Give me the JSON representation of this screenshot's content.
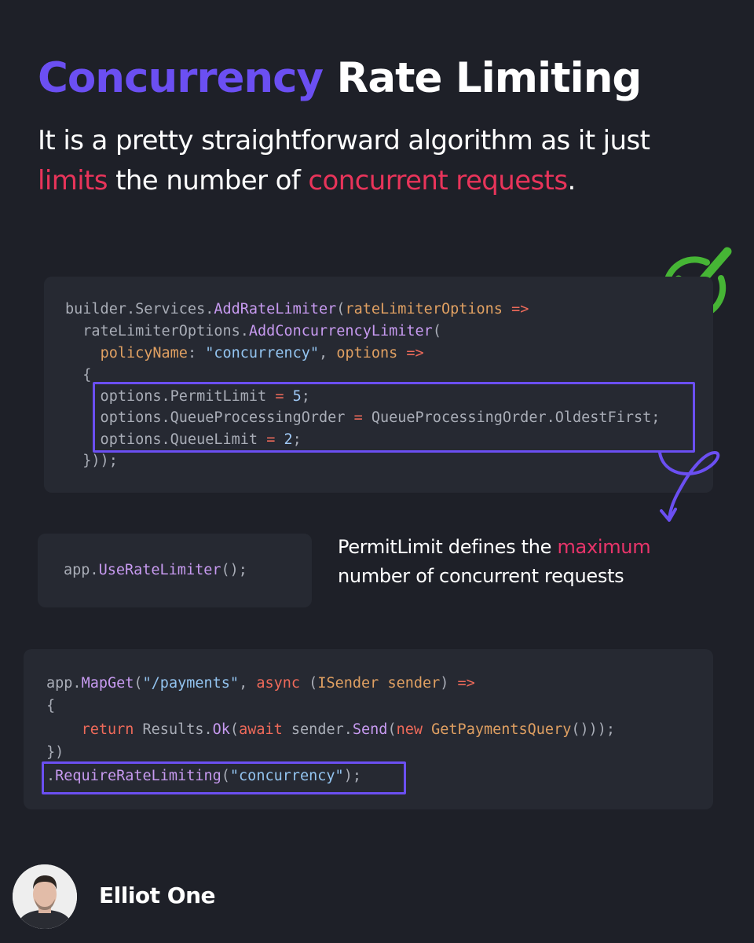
{
  "header": {
    "title_accent": "Concurrency",
    "title_rest": " Rate Limiting",
    "subtitle_part1": "It is a pretty straightforward algorithm as it just ",
    "subtitle_highlight1": "limits",
    "subtitle_part2": " the number of ",
    "subtitle_highlight2": "concurrent requests",
    "subtitle_part3": "."
  },
  "code1": {
    "lines": [
      [
        [
          "builder.Services.",
          "plain"
        ],
        [
          "AddRateLimiter",
          "fn"
        ],
        [
          "(",
          "plain"
        ],
        [
          "rateLimiterOptions",
          "param"
        ],
        [
          " ",
          "plain"
        ],
        [
          "=>",
          "op"
        ]
      ],
      [
        [
          "  rateLimiterOptions.",
          "plain"
        ],
        [
          "AddConcurrencyLimiter",
          "fn"
        ],
        [
          "(",
          "plain"
        ]
      ],
      [
        [
          "    ",
          "plain"
        ],
        [
          "policyName",
          "param"
        ],
        [
          ": ",
          "plain"
        ],
        [
          "\"concurrency\"",
          "str"
        ],
        [
          ", ",
          "plain"
        ],
        [
          "options",
          "param"
        ],
        [
          " ",
          "plain"
        ],
        [
          "=>",
          "op"
        ]
      ],
      [
        [
          "  {",
          "plain"
        ]
      ],
      [
        [
          "    options.PermitLimit ",
          "plain"
        ],
        [
          "=",
          "op"
        ],
        [
          " ",
          "plain"
        ],
        [
          "5",
          "num"
        ],
        [
          ";",
          "plain"
        ]
      ],
      [
        [
          "    options.QueueProcessingOrder ",
          "plain"
        ],
        [
          "=",
          "op"
        ],
        [
          " QueueProcessingOrder.OldestFirst;",
          "plain"
        ]
      ],
      [
        [
          "    options.QueueLimit ",
          "plain"
        ],
        [
          "=",
          "op"
        ],
        [
          " ",
          "plain"
        ],
        [
          "2",
          "num"
        ],
        [
          ";",
          "plain"
        ]
      ],
      [
        [
          "  }));",
          "plain"
        ]
      ]
    ]
  },
  "code2": {
    "lines": [
      [
        [
          "app.",
          "plain"
        ],
        [
          "UseRateLimiter",
          "fn"
        ],
        [
          "();",
          "plain"
        ]
      ]
    ]
  },
  "note": {
    "part1": "PermitLimit defines the ",
    "highlight": "maximum",
    "part2": "number of concurrent requests"
  },
  "code3": {
    "lines": [
      [
        [
          "app.",
          "plain"
        ],
        [
          "MapGet",
          "fn"
        ],
        [
          "(",
          "plain"
        ],
        [
          "\"/payments\"",
          "str"
        ],
        [
          ", ",
          "plain"
        ],
        [
          "async",
          "kw"
        ],
        [
          " (",
          "plain"
        ],
        [
          "ISender",
          "type"
        ],
        [
          " ",
          "plain"
        ],
        [
          "sender",
          "param"
        ],
        [
          ") ",
          "plain"
        ],
        [
          "=>",
          "op"
        ]
      ],
      [
        [
          "{",
          "plain"
        ]
      ],
      [
        [
          "    ",
          "plain"
        ],
        [
          "return",
          "kw"
        ],
        [
          " Results.",
          "plain"
        ],
        [
          "Ok",
          "fn"
        ],
        [
          "(",
          "plain"
        ],
        [
          "await",
          "kw"
        ],
        [
          " sender.",
          "plain"
        ],
        [
          "Send",
          "fn"
        ],
        [
          "(",
          "plain"
        ],
        [
          "new",
          "kw"
        ],
        [
          " ",
          "plain"
        ],
        [
          "GetPaymentsQuery",
          "type"
        ],
        [
          "()));",
          "plain"
        ]
      ],
      [
        [
          "})",
          "plain"
        ]
      ],
      [
        [
          ".",
          "plain"
        ],
        [
          "RequireRateLimiting",
          "fn"
        ],
        [
          "(",
          "plain"
        ],
        [
          "\"concurrency\"",
          "str"
        ],
        [
          ");",
          "plain"
        ]
      ]
    ]
  },
  "author": {
    "name": "Elliot One"
  },
  "icons": {
    "check": "check-circle-icon",
    "arrow": "curly-arrow-icon"
  },
  "colors": {
    "background": "#1e2028",
    "code_background": "#262932",
    "accent_purple": "#6b4ff2",
    "highlight_pink": "#e8345a",
    "check_green": "#46b535"
  }
}
